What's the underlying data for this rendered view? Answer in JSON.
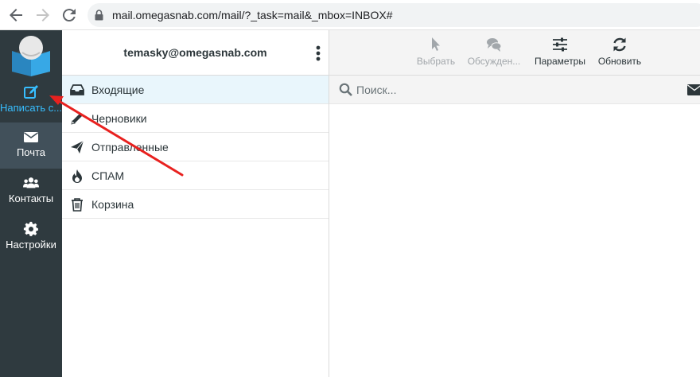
{
  "browser": {
    "url": "mail.omegasnab.com/mail/?_task=mail&_mbox=INBOX#"
  },
  "nav": {
    "compose": {
      "label": "Написать с...",
      "icon": "compose-icon"
    },
    "mail": {
      "label": "Почта",
      "icon": "envelope-icon"
    },
    "contacts": {
      "label": "Контакты",
      "icon": "contacts-icon"
    },
    "settings": {
      "label": "Настройки",
      "icon": "gear-icon"
    }
  },
  "account": {
    "email": "temasky@omegasnab.com"
  },
  "folders": [
    {
      "label": "Входящие",
      "icon": "inbox-icon",
      "selected": true
    },
    {
      "label": "Черновики",
      "icon": "pencil-icon",
      "selected": false
    },
    {
      "label": "Отправленные",
      "icon": "paper-plane-icon",
      "selected": false
    },
    {
      "label": "СПАМ",
      "icon": "fire-icon",
      "selected": false
    },
    {
      "label": "Корзина",
      "icon": "trash-icon",
      "selected": false
    }
  ],
  "toolbar": {
    "select_label": "Выбрать",
    "threads_label": "Обсужден...",
    "options_label": "Параметры",
    "refresh_label": "Обновить"
  },
  "search": {
    "placeholder": "Поиск..."
  },
  "colors": {
    "nav_bg": "#2f3a3f",
    "nav_selected_bg": "#41505a",
    "accent": "#37beff",
    "selected_folder_bg": "#e9f6fc",
    "annotation": "#e8211f"
  }
}
